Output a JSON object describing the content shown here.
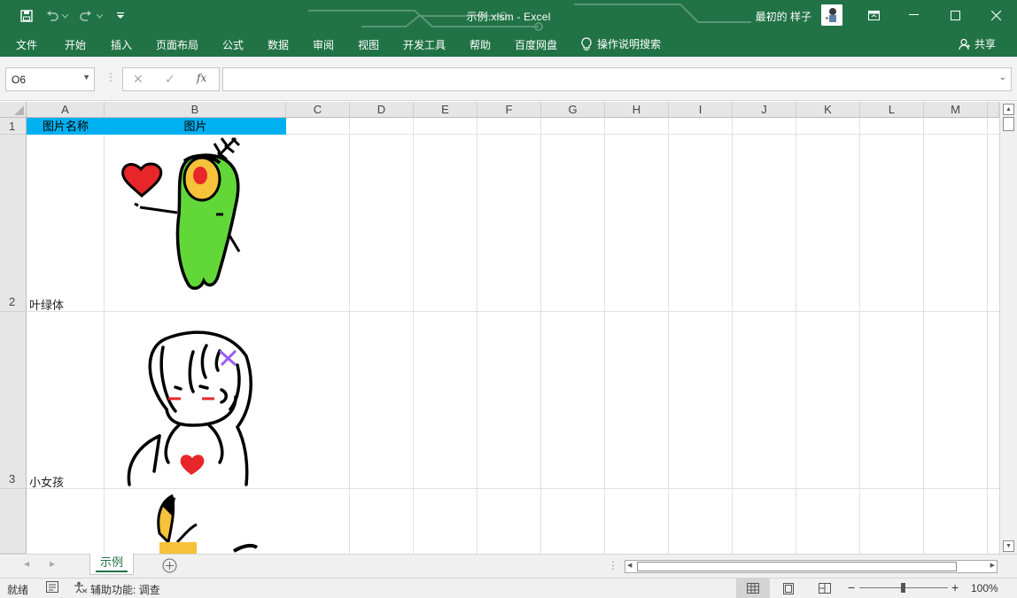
{
  "titlebar": {
    "title": "示例.xlsm  -  Excel",
    "user": "最初的 样子",
    "bg_color": "#217346"
  },
  "ribbon": {
    "tabs": [
      "文件",
      "开始",
      "插入",
      "页面布局",
      "公式",
      "数据",
      "审阅",
      "视图",
      "开发工具",
      "帮助",
      "百度网盘"
    ],
    "tell_me": "操作说明搜索",
    "share": "共享"
  },
  "formula_bar": {
    "name_box": "O6",
    "formula": "",
    "fx": "fx"
  },
  "grid": {
    "columns": [
      "A",
      "B",
      "C",
      "D",
      "E",
      "F",
      "G",
      "H",
      "I",
      "J",
      "K",
      "L",
      "M"
    ],
    "rows": [
      "1",
      "2",
      "3"
    ],
    "header_fill": "#00b0f0",
    "cells": {
      "A1": "图片名称",
      "B1": "图片",
      "A2": "叶绿体",
      "A3": "小女孩"
    }
  },
  "sheets": [
    "示例"
  ],
  "status": {
    "ready": "就绪",
    "accessibility": "辅助功能: 调查",
    "zoom": "100%"
  }
}
